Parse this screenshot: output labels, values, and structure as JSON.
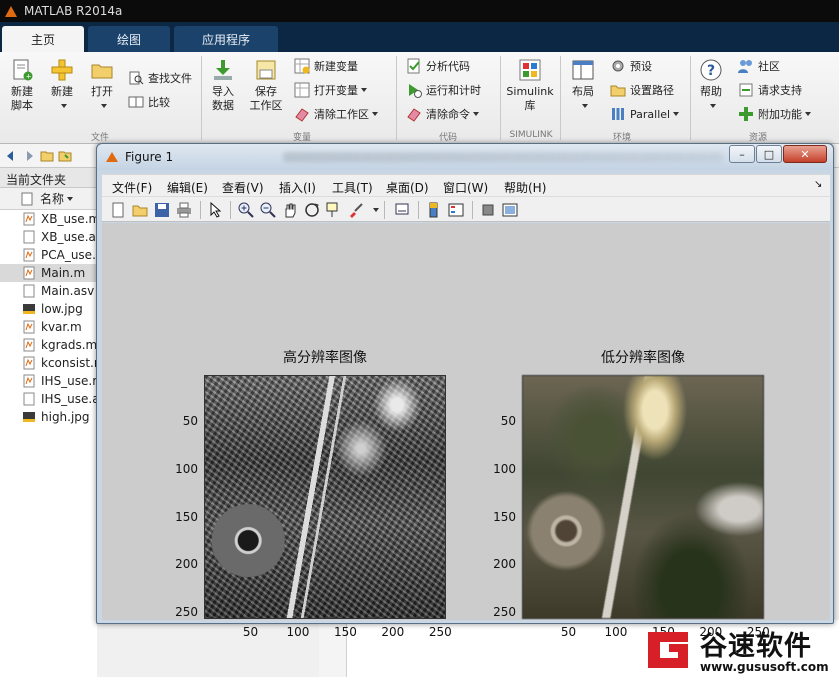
{
  "app": {
    "title": "MATLAB R2014a"
  },
  "tabs": [
    {
      "label": "主页",
      "active": true
    },
    {
      "label": "绘图",
      "active": false
    },
    {
      "label": "应用程序",
      "active": false
    }
  ],
  "ribbon": {
    "new_script": "新建\n脚本",
    "new": "新建",
    "open": "打开",
    "find_files": "查找文件",
    "compare": "比较",
    "import_data": "导入\n数据",
    "save_workspace": "保存\n工作区",
    "new_variable": "新建变量",
    "open_variable": "打开变量",
    "clear_workspace": "清除工作区",
    "analyze_code": "分析代码",
    "run_and_time": "运行和计时",
    "clear_commands": "清除命令",
    "simulink_lib": "Simulink\n库",
    "layout": "布局",
    "preferences": "预设",
    "set_path": "设置路径",
    "parallel": "Parallel",
    "help": "帮助",
    "community": "社区",
    "request_support": "请求支持",
    "add_ons": "附加功能",
    "groups": {
      "file": "文件",
      "variable": "变量",
      "code": "代码",
      "simulink": "SIMULINK",
      "environment": "环境",
      "resources": "资源"
    }
  },
  "file_browser": {
    "header": "当前文件夹",
    "column_name": "名称",
    "files": [
      {
        "name": "XB_use.m",
        "type": "m",
        "selected": false
      },
      {
        "name": "XB_use.asv",
        "type": "asv",
        "selected": false
      },
      {
        "name": "PCA_use.m",
        "type": "m",
        "selected": false
      },
      {
        "name": "Main.m",
        "type": "m",
        "selected": true
      },
      {
        "name": "Main.asv",
        "type": "asv",
        "selected": false
      },
      {
        "name": "low.jpg",
        "type": "jpg",
        "selected": false
      },
      {
        "name": "kvar.m",
        "type": "m",
        "selected": false
      },
      {
        "name": "kgrads.m",
        "type": "m",
        "selected": false
      },
      {
        "name": "kconsist.m",
        "type": "m",
        "selected": false
      },
      {
        "name": "IHS_use.m",
        "type": "m",
        "selected": false
      },
      {
        "name": "IHS_use.asv",
        "type": "asv",
        "selected": false
      },
      {
        "name": "high.jpg",
        "type": "jpg",
        "selected": false
      }
    ]
  },
  "figure": {
    "title": "Figure 1",
    "menu": [
      "文件(F)",
      "编辑(E)",
      "查看(V)",
      "插入(I)",
      "工具(T)",
      "桌面(D)",
      "窗口(W)",
      "帮助(H)"
    ],
    "axes": [
      {
        "title": "高分辨率图像",
        "xticks": [
          "50",
          "100",
          "150",
          "200",
          "250"
        ],
        "yticks": [
          "50",
          "100",
          "150",
          "200",
          "250"
        ]
      },
      {
        "title": "低分辨率图像",
        "xticks": [
          "50",
          "100",
          "150",
          "200",
          "250"
        ],
        "yticks": [
          "50",
          "100",
          "150",
          "200",
          "250"
        ]
      }
    ],
    "axis_range": [
      1,
      256
    ]
  },
  "watermark": {
    "title": "谷速软件",
    "url": "www.gususoft.com"
  },
  "colors": {
    "title_bar": "#0b0b0b",
    "tab_strip": "#0c2744",
    "matlab_orange": "#e06a10",
    "figure_bg": "#cccccc",
    "watermark_red": "#d61f26"
  }
}
